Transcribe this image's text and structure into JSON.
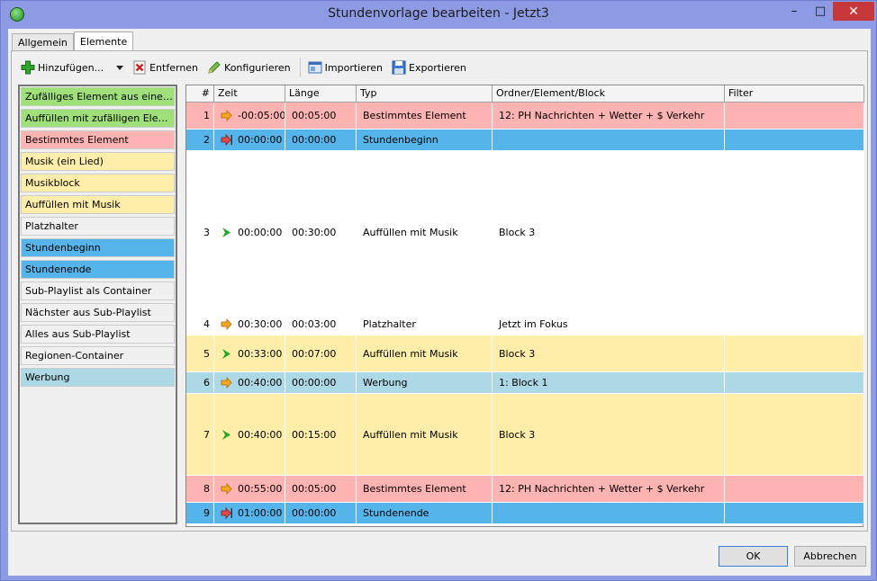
{
  "window": {
    "title": "Stundenvorlage bearbeiten - Jetzt3",
    "close_glyph": "✕",
    "minimize_glyph": "–",
    "maximize_glyph": "□"
  },
  "tabs": [
    {
      "label": "Allgemein"
    },
    {
      "label": "Elemente",
      "active": true
    }
  ],
  "toolbar": {
    "add_label": "Hinzufügen...",
    "remove_label": "Entfernen",
    "configure_label": "Konfigurieren",
    "import_label": "Importieren",
    "export_label": "Exportieren"
  },
  "palette": [
    {
      "label": "Zufälliges Element aus einem be...",
      "color": "#9fe07a"
    },
    {
      "label": "Auffüllen mit zufälligen Elementen",
      "color": "#9fe07a"
    },
    {
      "label": "Bestimmtes Element",
      "color": "#ffb3b3"
    },
    {
      "label": "Musik (ein Lied)",
      "color": "#ffeeaa"
    },
    {
      "label": "Musikblock",
      "color": "#ffeeaa"
    },
    {
      "label": "Auffüllen mit Musik",
      "color": "#ffeeaa"
    },
    {
      "label": "Platzhalter",
      "color": "#f0f0f0"
    },
    {
      "label": "Stundenbeginn",
      "color": "#55b5eb"
    },
    {
      "label": "Stundenende",
      "color": "#55b5eb"
    },
    {
      "label": "Sub-Playlist als Container",
      "color": "#f0f0f0"
    },
    {
      "label": "Nächster aus Sub-Playlist",
      "color": "#f0f0f0"
    },
    {
      "label": "Alles aus Sub-Playlist",
      "color": "#f0f0f0"
    },
    {
      "label": "Regionen-Container",
      "color": "#f0f0f0"
    },
    {
      "label": "Werbung",
      "color": "#add8e6"
    }
  ],
  "grid": {
    "columns": [
      "#",
      "Zeit",
      "Länge",
      "Typ",
      "Ordner/Element/Block",
      "Filter"
    ],
    "rows": [
      {
        "num": "1",
        "icon": "orange-arrow-icon",
        "time": "-00:05:00",
        "length": "00:05:00",
        "type": "Bestimmtes Element",
        "target": "12: PH Nachrichten + Wetter + $ Verkehr",
        "filter": "",
        "color": "#ffb3b3"
      },
      {
        "num": "2",
        "icon": "red-arrow-bar-icon",
        "time": "00:00:00",
        "length": "00:00:00",
        "type": "Stundenbeginn",
        "target": "",
        "filter": "",
        "color": "#55b5eb"
      },
      {
        "num": "3",
        "icon": "green-chevron-icon",
        "time": "00:00:00",
        "length": "00:30:00",
        "type": "Auffüllen mit Musik",
        "target": "Block 3",
        "filter": "",
        "color": "#ffffff"
      },
      {
        "num": "4",
        "icon": "orange-arrow-icon",
        "time": "00:30:00",
        "length": "00:03:00",
        "type": "Platzhalter",
        "target": "Jetzt im Fokus",
        "filter": "",
        "color": "#ffffff"
      },
      {
        "num": "5",
        "icon": "green-chevron-icon",
        "time": "00:33:00",
        "length": "00:07:00",
        "type": "Auffüllen mit Musik",
        "target": "Block 3",
        "filter": "",
        "color": "#ffeeaa"
      },
      {
        "num": "6",
        "icon": "orange-arrow-icon",
        "time": "00:40:00",
        "length": "00:00:00",
        "type": "Werbung",
        "target": "1: Block 1",
        "filter": "",
        "color": "#add8e6"
      },
      {
        "num": "7",
        "icon": "green-chevron-icon",
        "time": "00:40:00",
        "length": "00:15:00",
        "type": "Auffüllen mit Musik",
        "target": "Block 3",
        "filter": "",
        "color": "#ffeeaa"
      },
      {
        "num": "8",
        "icon": "orange-arrow-icon",
        "time": "00:55:00",
        "length": "00:05:00",
        "type": "Bestimmtes Element",
        "target": "12: PH Nachrichten + Wetter + $ Verkehr",
        "filter": "",
        "color": "#ffb3b3"
      },
      {
        "num": "9",
        "icon": "red-arrow-bar-icon",
        "time": "01:00:00",
        "length": "00:00:00",
        "type": "Stundenende",
        "target": "",
        "filter": "",
        "color": "#55b5eb"
      }
    ]
  },
  "footer": {
    "ok_label": "OK",
    "cancel_label": "Abbrechen"
  }
}
